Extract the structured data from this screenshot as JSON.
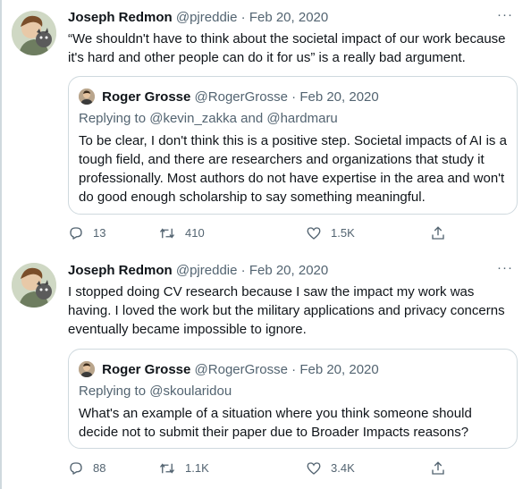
{
  "tweets": [
    {
      "author": {
        "name": "Joseph Redmon",
        "handle": "@pjreddie"
      },
      "separator": "·",
      "date": "Feb 20, 2020",
      "more": "···",
      "text": "“We shouldn't have to think about the societal impact of our work because it's hard and other people can do it for us” is a really bad argument.",
      "quote": {
        "author": {
          "name": "Roger Grosse",
          "handle": "@RogerGrosse"
        },
        "separator": "·",
        "date": "Feb 20, 2020",
        "replying_label": "Replying to",
        "replying_to": "@kevin_zakka and @hardmaru",
        "text": "To be clear, I don't think this is a positive step. Societal impacts of AI is a tough field, and there are researchers and organizations that study it professionally. Most authors do not have expertise in the area and won't do good enough scholarship to say something meaningful."
      },
      "actions": {
        "replies": "13",
        "retweets": "410",
        "likes": "1.5K",
        "share": ""
      }
    },
    {
      "author": {
        "name": "Joseph Redmon",
        "handle": "@pjreddie"
      },
      "separator": "·",
      "date": "Feb 20, 2020",
      "more": "···",
      "text": "I stopped doing CV research because I saw the impact my work was having. I loved the work but the military applications and privacy concerns eventually became impossible to ignore.",
      "quote": {
        "author": {
          "name": "Roger Grosse",
          "handle": "@RogerGrosse"
        },
        "separator": "·",
        "date": "Feb 20, 2020",
        "replying_label": "Replying to",
        "replying_to": "@skoularidou",
        "text": "What's an example of a situation where you think someone should decide not to submit their paper due to Broader Impacts reasons?"
      },
      "actions": {
        "replies": "88",
        "retweets": "1.1K",
        "likes": "3.4K",
        "share": ""
      }
    }
  ],
  "colors": {
    "secondary_text": "#536471",
    "border": "#cfd9de",
    "primary_text": "#0f1419"
  },
  "icons": [
    "reply-icon",
    "retweet-icon",
    "like-icon",
    "share-icon",
    "more-icon"
  ]
}
